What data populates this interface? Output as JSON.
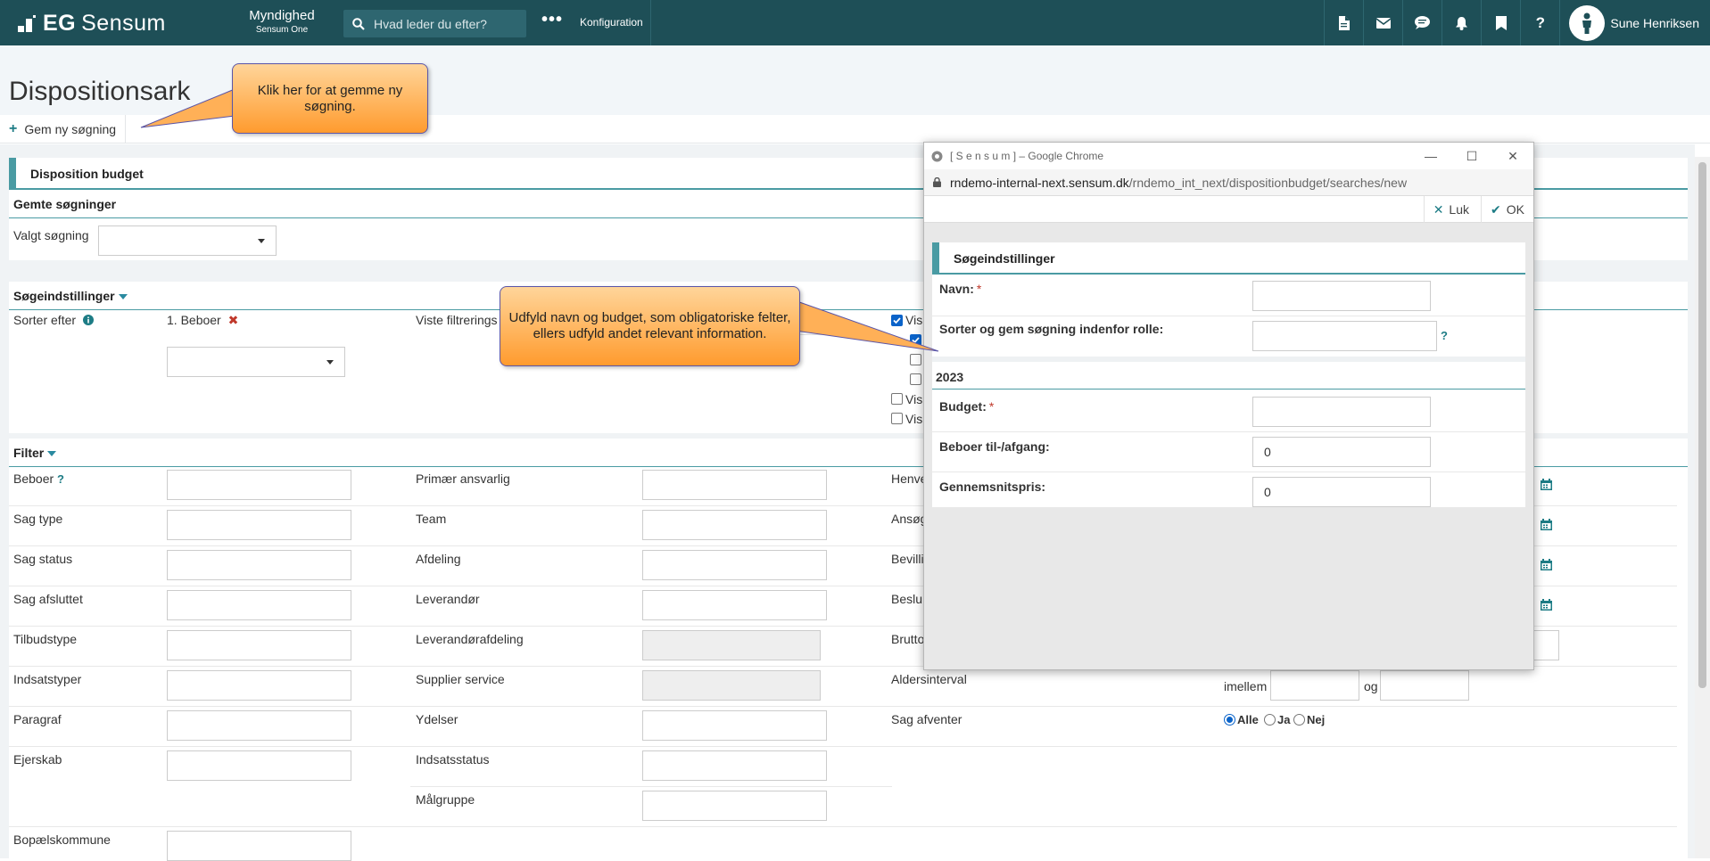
{
  "nav": {
    "brand_prefix": "EG",
    "brand_name": "Sensum",
    "context_title": "Myndighed",
    "context_sub": "Sensum One",
    "search_placeholder": "Hvad leder du efter?",
    "more": "•••",
    "config_label": "Konfiguration",
    "user_name": "Sune Henriksen",
    "icons": [
      "document-icon",
      "mail-icon",
      "chat-icon",
      "bell-icon",
      "bookmark-icon",
      "help-icon"
    ],
    "help_glyph": "?"
  },
  "page": {
    "title": "Dispositionsark",
    "save_search_label": "Gem ny søgning"
  },
  "callouts": {
    "save_hint": "Klik her for at gemme ny søgning.",
    "fill_hint": "Udfyld navn og budget, som obligatoriske felter, ellers udfyld andet relevant information."
  },
  "budget": {
    "section_title": "Disposition budget",
    "saved_searches_title": "Gemte søgninger",
    "chosen_search_label": "Valgt søgning"
  },
  "settings": {
    "title": "Søgeindstillinger",
    "sort_by_label": "Sorter efter",
    "sort_item": "1. Beboer",
    "shown_filters_label": "Viste filtrerings",
    "visible_prefix": "Vis",
    "checkboxes": [
      true,
      true,
      false,
      false,
      false,
      false
    ]
  },
  "filter": {
    "title": "Filter",
    "col1": [
      "Beboer",
      "Sag type",
      "Sag status",
      "Sag afsluttet",
      "Tilbudstype",
      "Indsatstyper",
      "Paragraf",
      "Ejerskab",
      "Bopælskommune"
    ],
    "col2": [
      "Primær ansvarlig",
      "Team",
      "Afdeling",
      "Leverandør",
      "Leverandørafdeling",
      "Supplier service",
      "Ydelser",
      "Indsatsstatus",
      "Målgruppe"
    ],
    "col3": [
      "Henve",
      "Ansøg",
      "Bevilli",
      "Beslu",
      "Brutto",
      "Aldersinterval",
      "Sag afventer"
    ],
    "age_between": "imellem",
    "age_and": "og",
    "radio": [
      "Alle",
      "Ja",
      "Nej"
    ],
    "radio_selected": "Alle",
    "beboer_help": "?"
  },
  "popup": {
    "window_title": "[ S e n s u m ] – Google Chrome",
    "url_host": "rndemo-internal-next.sensum.dk",
    "url_path": "/rndemo_int_next/dispositionbudget/searches/new",
    "close_label": "Luk",
    "ok_label": "OK",
    "section_title": "Søgeindstillinger",
    "name_label": "Navn:",
    "req_mark": "*",
    "sort_role_label": "Sorter og gem søgning indenfor rolle:",
    "help_glyph": "?",
    "year": "2023",
    "budget_label": "Budget:",
    "resident_change_label": "Beboer til-/afgang:",
    "resident_change_value": "0",
    "avg_price_label": "Gennemsnitspris:",
    "avg_price_value": "0"
  }
}
